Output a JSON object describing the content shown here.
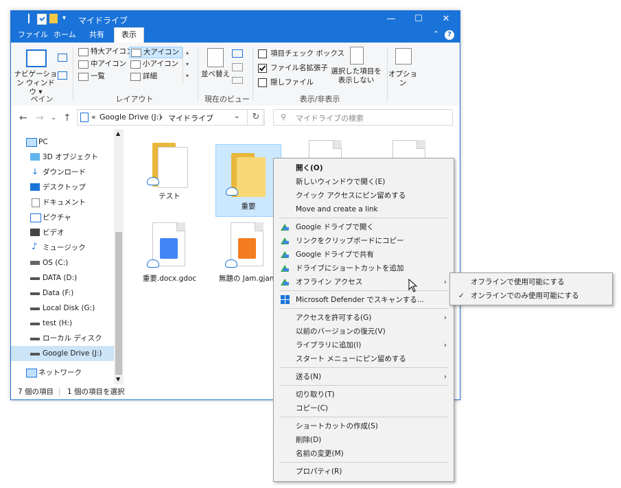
{
  "window": {
    "title": "マイドライブ",
    "min": "—",
    "max": "☐",
    "close": "✕"
  },
  "ribbon_tabs": [
    "ファイル",
    "ホーム",
    "共有",
    "表示"
  ],
  "ribbon": {
    "nav_pane_label": "ナビゲーション ウィンドウ ▾",
    "pane_group": "ペイン",
    "layout_items": [
      "特大アイコン",
      "大アイコン",
      "中アイコン",
      "小アイコン",
      "一覧",
      "詳細"
    ],
    "layout_group": "レイアウト",
    "sort_label": "並べ替え",
    "current_view_group": "現在のビュー",
    "show_hide": {
      "item_checkbox": "項目チェック ボックス",
      "file_ext": "ファイル名拡張子",
      "hidden_files": "隠しファイル",
      "hide_selected": "選択した項目を 表示しない",
      "group": "表示/非表示"
    },
    "options": "オプション"
  },
  "address": {
    "prefix": "«",
    "path1": "Google Drive (J:)",
    "sep": "›",
    "path2": "マイドライブ",
    "search_placeholder": "マイドライブの検索"
  },
  "nav": [
    "PC",
    "3D オブジェクト",
    "ダウンロード",
    "デスクトップ",
    "ドキュメント",
    "ピクチャ",
    "ビデオ",
    "ミュージック",
    "OS (C:)",
    "DATA (D:)",
    "Data (F:)",
    "Local Disk (G:)",
    "test (H:)",
    "ローカル ディスク (I:)",
    "Google Drive (J:)",
    "ネットワーク"
  ],
  "files": [
    "テスト",
    "重要",
    "重要.docx.gdoc",
    "無題の Jam.gjam"
  ],
  "status": {
    "count": "7 個の項目",
    "selected": "1 個の項目を選択"
  },
  "context_menu": [
    "開く(O)",
    "新しいウィンドウで開く(E)",
    "クイック アクセスにピン留めする",
    "Move and create a link",
    "Google ドライブで開く",
    "リンクをクリップボードにコピー",
    "Google ドライブで共有",
    "ドライブにショートカットを追加",
    "オフライン アクセス",
    "Microsoft Defender でスキャンする...",
    "アクセスを許可する(G)",
    "以前のバージョンの復元(V)",
    "ライブラリに追加(I)",
    "スタート メニューにピン留めする",
    "送る(N)",
    "切り取り(T)",
    "コピー(C)",
    "ショートカットの作成(S)",
    "削除(D)",
    "名前の変更(M)",
    "プロパティ(R)"
  ],
  "submenu": [
    "オフラインで使用可能にする",
    "オンラインでのみ使用可能にする"
  ],
  "colors": {
    "titlebar": "#1a73d8",
    "selection": "#cce8ff"
  }
}
